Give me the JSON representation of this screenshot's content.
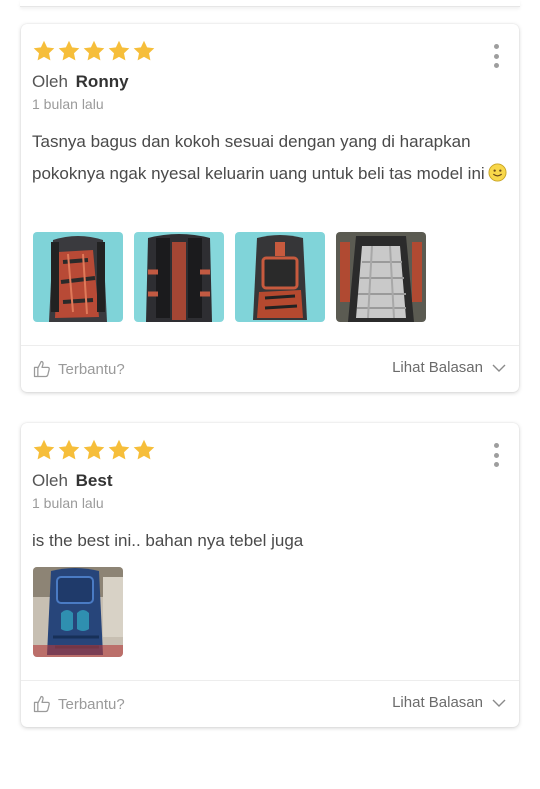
{
  "reviews": [
    {
      "rating": 5,
      "by_prefix": "Oleh",
      "author": "Ronny",
      "time": "1 bulan lalu",
      "text": "Tasnya bagus dan kokoh sesuai dengan yang di harapkan pokoknya ngak nyesal keluarin uang untuk beli tas model ini",
      "emoji": "smiley-icon",
      "photos": [
        "backpack-front-photo",
        "backpack-back-photo",
        "backpack-side-photo",
        "backpack-inside-photo"
      ],
      "helpful_label": "Terbantu?",
      "replies_label": "Lihat Balasan"
    },
    {
      "rating": 5,
      "by_prefix": "Oleh",
      "author": "Best",
      "time": "1 bulan lalu",
      "text": "is the best ini.. bahan nya tebel juga",
      "photos": [
        "blue-backpack-photo"
      ],
      "helpful_label": "Terbantu?",
      "replies_label": "Lihat Balasan"
    }
  ],
  "colors": {
    "star": "#F6BE3A",
    "text": "#4a4a4a",
    "muted": "#9a9a9a"
  }
}
